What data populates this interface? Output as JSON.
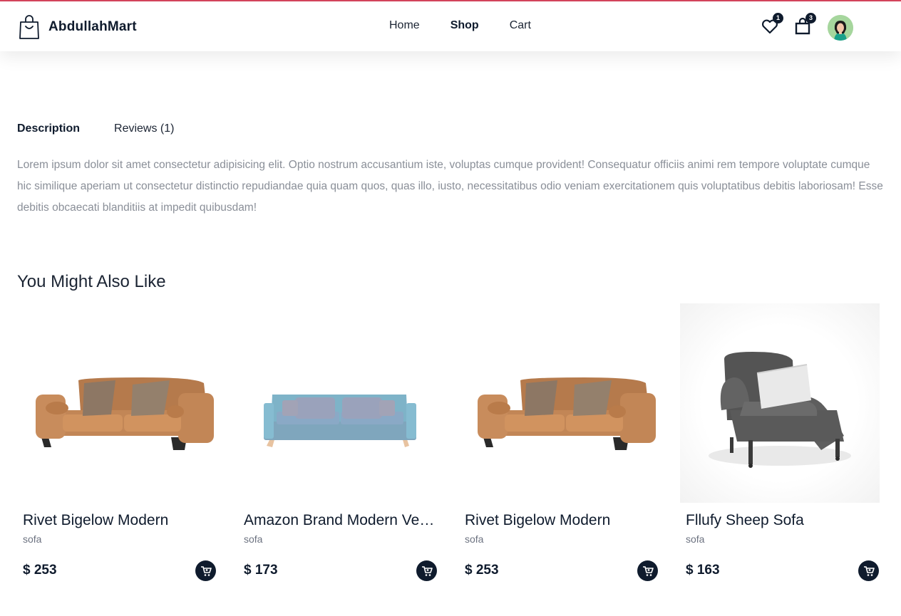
{
  "header": {
    "brand": "AbdullahMart",
    "nav": [
      {
        "label": "Home",
        "active": false
      },
      {
        "label": "Shop",
        "active": true
      },
      {
        "label": "Cart",
        "active": false
      }
    ],
    "wishlist_count": "1",
    "cart_count": "3",
    "icons": [
      "shopping-bag-icon",
      "heart-icon",
      "cart-bag-icon",
      "user-avatar"
    ]
  },
  "tabs": [
    {
      "label": "Description",
      "active": true
    },
    {
      "label": "Reviews (1)",
      "active": false
    }
  ],
  "description": "Lorem ipsum dolor sit amet consectetur adipisicing elit. Optio nostrum accusantium iste, voluptas cumque provident! Consequatur officiis animi rem tempore voluptate cumque hic similique aperiam ut consectetur distinctio repudiandae quia quam quos, quas illo, iusto, necessitatibus odio veniam exercitationem quis voluptatibus debitis laboriosam! Esse debitis obcaecati blanditiis at impedit quibusdam!",
  "related": {
    "title": "You Might Also Like",
    "products": [
      {
        "name": "Rivet Bigelow Modern",
        "category": "sofa",
        "price": "$ 253",
        "image": "brown-leather-sofa"
      },
      {
        "name": "Amazon Brand Modern Velvet Sofa",
        "category": "sofa",
        "price": "$ 173",
        "image": "blue-fabric-sofa"
      },
      {
        "name": "Rivet Bigelow Modern",
        "category": "sofa",
        "price": "$ 253",
        "image": "brown-leather-sofa"
      },
      {
        "name": "Fllufy Sheep Sofa",
        "category": "sofa",
        "price": "$ 163",
        "image": "grey-armchair"
      }
    ]
  },
  "colors": {
    "primary": "#0f1b2d",
    "accent_line": "#d6455d",
    "muted_text": "#8a8f98"
  }
}
